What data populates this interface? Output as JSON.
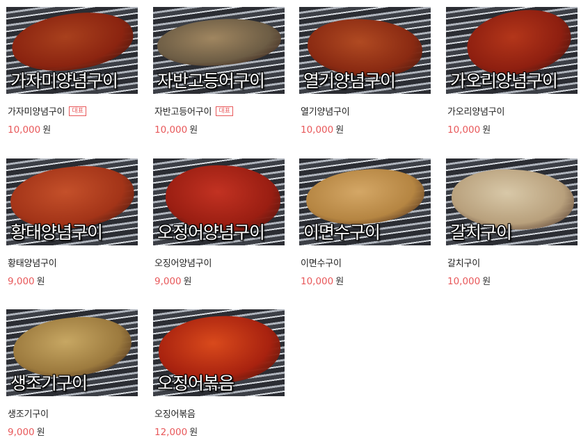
{
  "colors": {
    "accent": "#e8585a",
    "text": "#222222",
    "background": "#ffffff"
  },
  "items": [
    {
      "name": "가자미양념구이",
      "photo_caption": "가자미양념구이",
      "badge": "대표",
      "price": "10,000",
      "currency": "원",
      "food": [
        "#8b2410",
        "#a8401d"
      ]
    },
    {
      "name": "자반고등어구이",
      "photo_caption": "자반고등어구이",
      "badge": "대표",
      "price": "10,000",
      "currency": "원",
      "food": [
        "#6d5d45",
        "#a08660"
      ]
    },
    {
      "name": "열기양념구이",
      "photo_caption": "열기양념구이",
      "badge": null,
      "price": "10,000",
      "currency": "원",
      "food": [
        "#8a2a12",
        "#b04a22"
      ]
    },
    {
      "name": "가오리양념구이",
      "photo_caption": "가오리양념구이",
      "badge": null,
      "price": "10,000",
      "currency": "원",
      "food": [
        "#8e1f10",
        "#b3361a"
      ]
    },
    {
      "name": "황태양념구이",
      "photo_caption": "황태양념구이",
      "badge": null,
      "price": "9,000",
      "currency": "원",
      "food": [
        "#a33418",
        "#c4502a"
      ]
    },
    {
      "name": "오징어양념구이",
      "photo_caption": "오징어양념구이",
      "badge": null,
      "price": "9,000",
      "currency": "원",
      "food": [
        "#9a1e12",
        "#c23222"
      ]
    },
    {
      "name": "이면수구이",
      "photo_caption": "이면수구이",
      "badge": null,
      "price": "10,000",
      "currency": "원",
      "food": [
        "#b58542",
        "#d4a766"
      ]
    },
    {
      "name": "갈치구이",
      "photo_caption": "갈치구이",
      "badge": null,
      "price": "10,000",
      "currency": "원",
      "food": [
        "#b8a07c",
        "#d8c8a8"
      ]
    },
    {
      "name": "생조기구이",
      "photo_caption": "생조기구이",
      "badge": null,
      "price": "9,000",
      "currency": "원",
      "food": [
        "#9c7a3e",
        "#c7a763"
      ]
    },
    {
      "name": "오징어볶음",
      "photo_caption": "오징어볶음",
      "badge": null,
      "price": "12,000",
      "currency": "원",
      "food": [
        "#a8220f",
        "#d94a1c"
      ]
    }
  ]
}
